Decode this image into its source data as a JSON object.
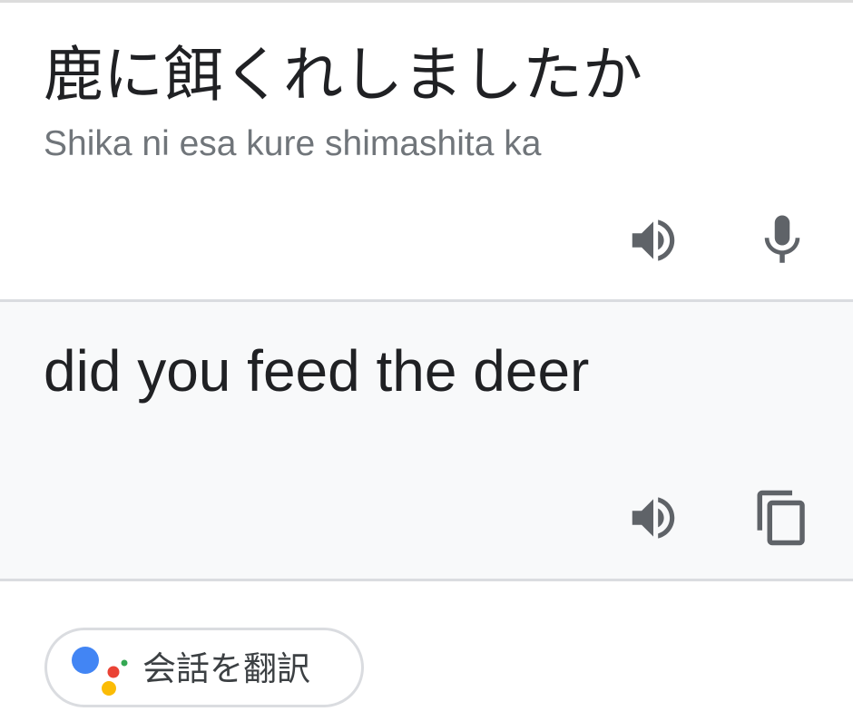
{
  "source": {
    "text": "鹿に餌くれしましたか",
    "romanization": "Shika ni esa kure shimashita ka",
    "actions": [
      "speaker-icon",
      "mic-icon"
    ]
  },
  "translation": {
    "text": "did you feed the deer",
    "actions": [
      "speaker-icon",
      "copy-icon"
    ]
  },
  "conversation_chip": {
    "label": "会話を翻訳",
    "icon": "google-assistant-icon"
  },
  "colors": {
    "primary_text": "#202124",
    "secondary_text": "#70757a",
    "icon": "#5f6368",
    "translation_background": "#f8f9fa",
    "divider": "#dadce0",
    "assistant_blue": "#4285f4",
    "assistant_red": "#ea4335",
    "assistant_yellow": "#fbbc05",
    "assistant_green": "#34a853"
  }
}
